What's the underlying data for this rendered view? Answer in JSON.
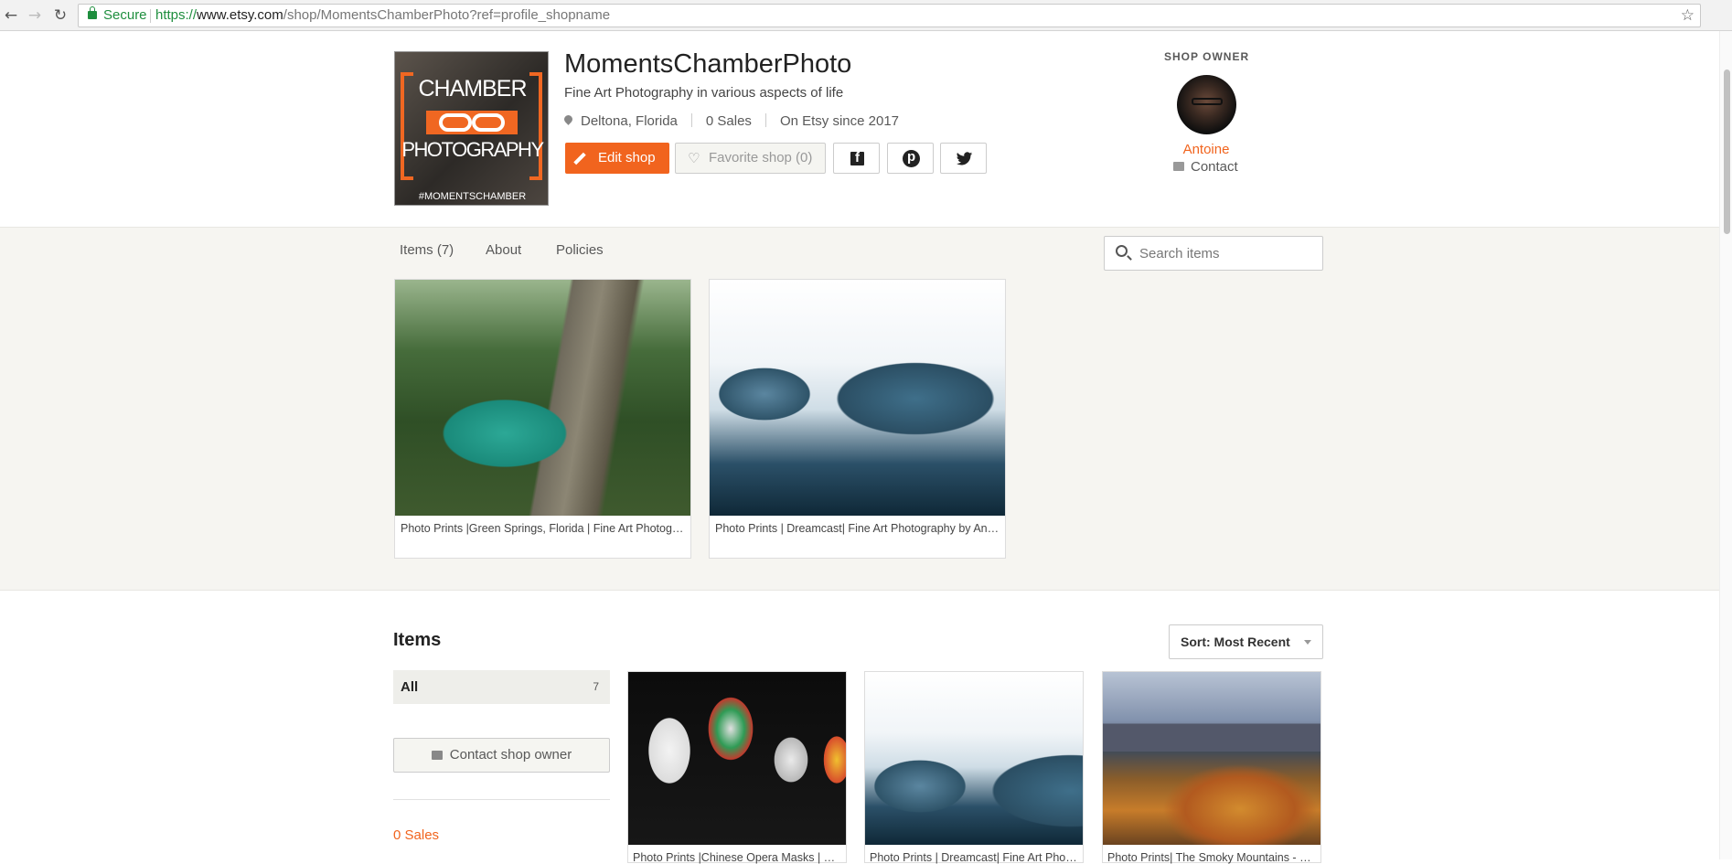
{
  "browser": {
    "secure_label": "Secure",
    "url_scheme": "https://",
    "url_host": "www.etsy.com",
    "url_path": "/shop/MomentsChamberPhoto?ref=profile_shopname",
    "icons": [
      "back-icon",
      "forward-icon",
      "reload-icon",
      "lock-icon",
      "bookmark-star-icon"
    ]
  },
  "logo": {
    "line1": "CHAMBER",
    "line2": "PHOTOGRAPHY",
    "line3": "#MOMENTSCHAMBER"
  },
  "shop": {
    "name": "MomentsChamberPhoto",
    "tagline": "Fine Art Photography in various aspects of life",
    "location": "Deltona, Florida",
    "sales": "0 Sales",
    "since": "On Etsy since 2017",
    "edit_label": "Edit shop",
    "favorite_label": "Favorite shop (0)"
  },
  "owner": {
    "label": "SHOP OWNER",
    "name": "Antoine",
    "contact": "Contact"
  },
  "tabs": [
    {
      "label": "Items (7)"
    },
    {
      "label": "About"
    },
    {
      "label": "Policies"
    }
  ],
  "search": {
    "placeholder": "Search items"
  },
  "featured": [
    {
      "title": "Photo Prints |Green Springs, Florida | Fine Art Photography by Antoine"
    },
    {
      "title": "Photo Prints | Dreamcast| Fine Art Photography by Antoine"
    }
  ],
  "items_section": {
    "title": "Items",
    "sort_label": "Sort: Most Recent",
    "category_all": "All",
    "category_count": "7",
    "contact_owner": "Contact shop owner",
    "sales": "0 Sales"
  },
  "items": [
    {
      "title": "Photo Prints |Chinese Opera Masks | Fine Art Photography"
    },
    {
      "title": "Photo Prints | Dreamcast| Fine Art Photography"
    },
    {
      "title": "Photo Prints| The Smoky Mountains - Fine Art Photography"
    }
  ],
  "colors": {
    "accent": "#f1641e",
    "band": "#f6f5f1",
    "secure": "#1e8e3e"
  }
}
